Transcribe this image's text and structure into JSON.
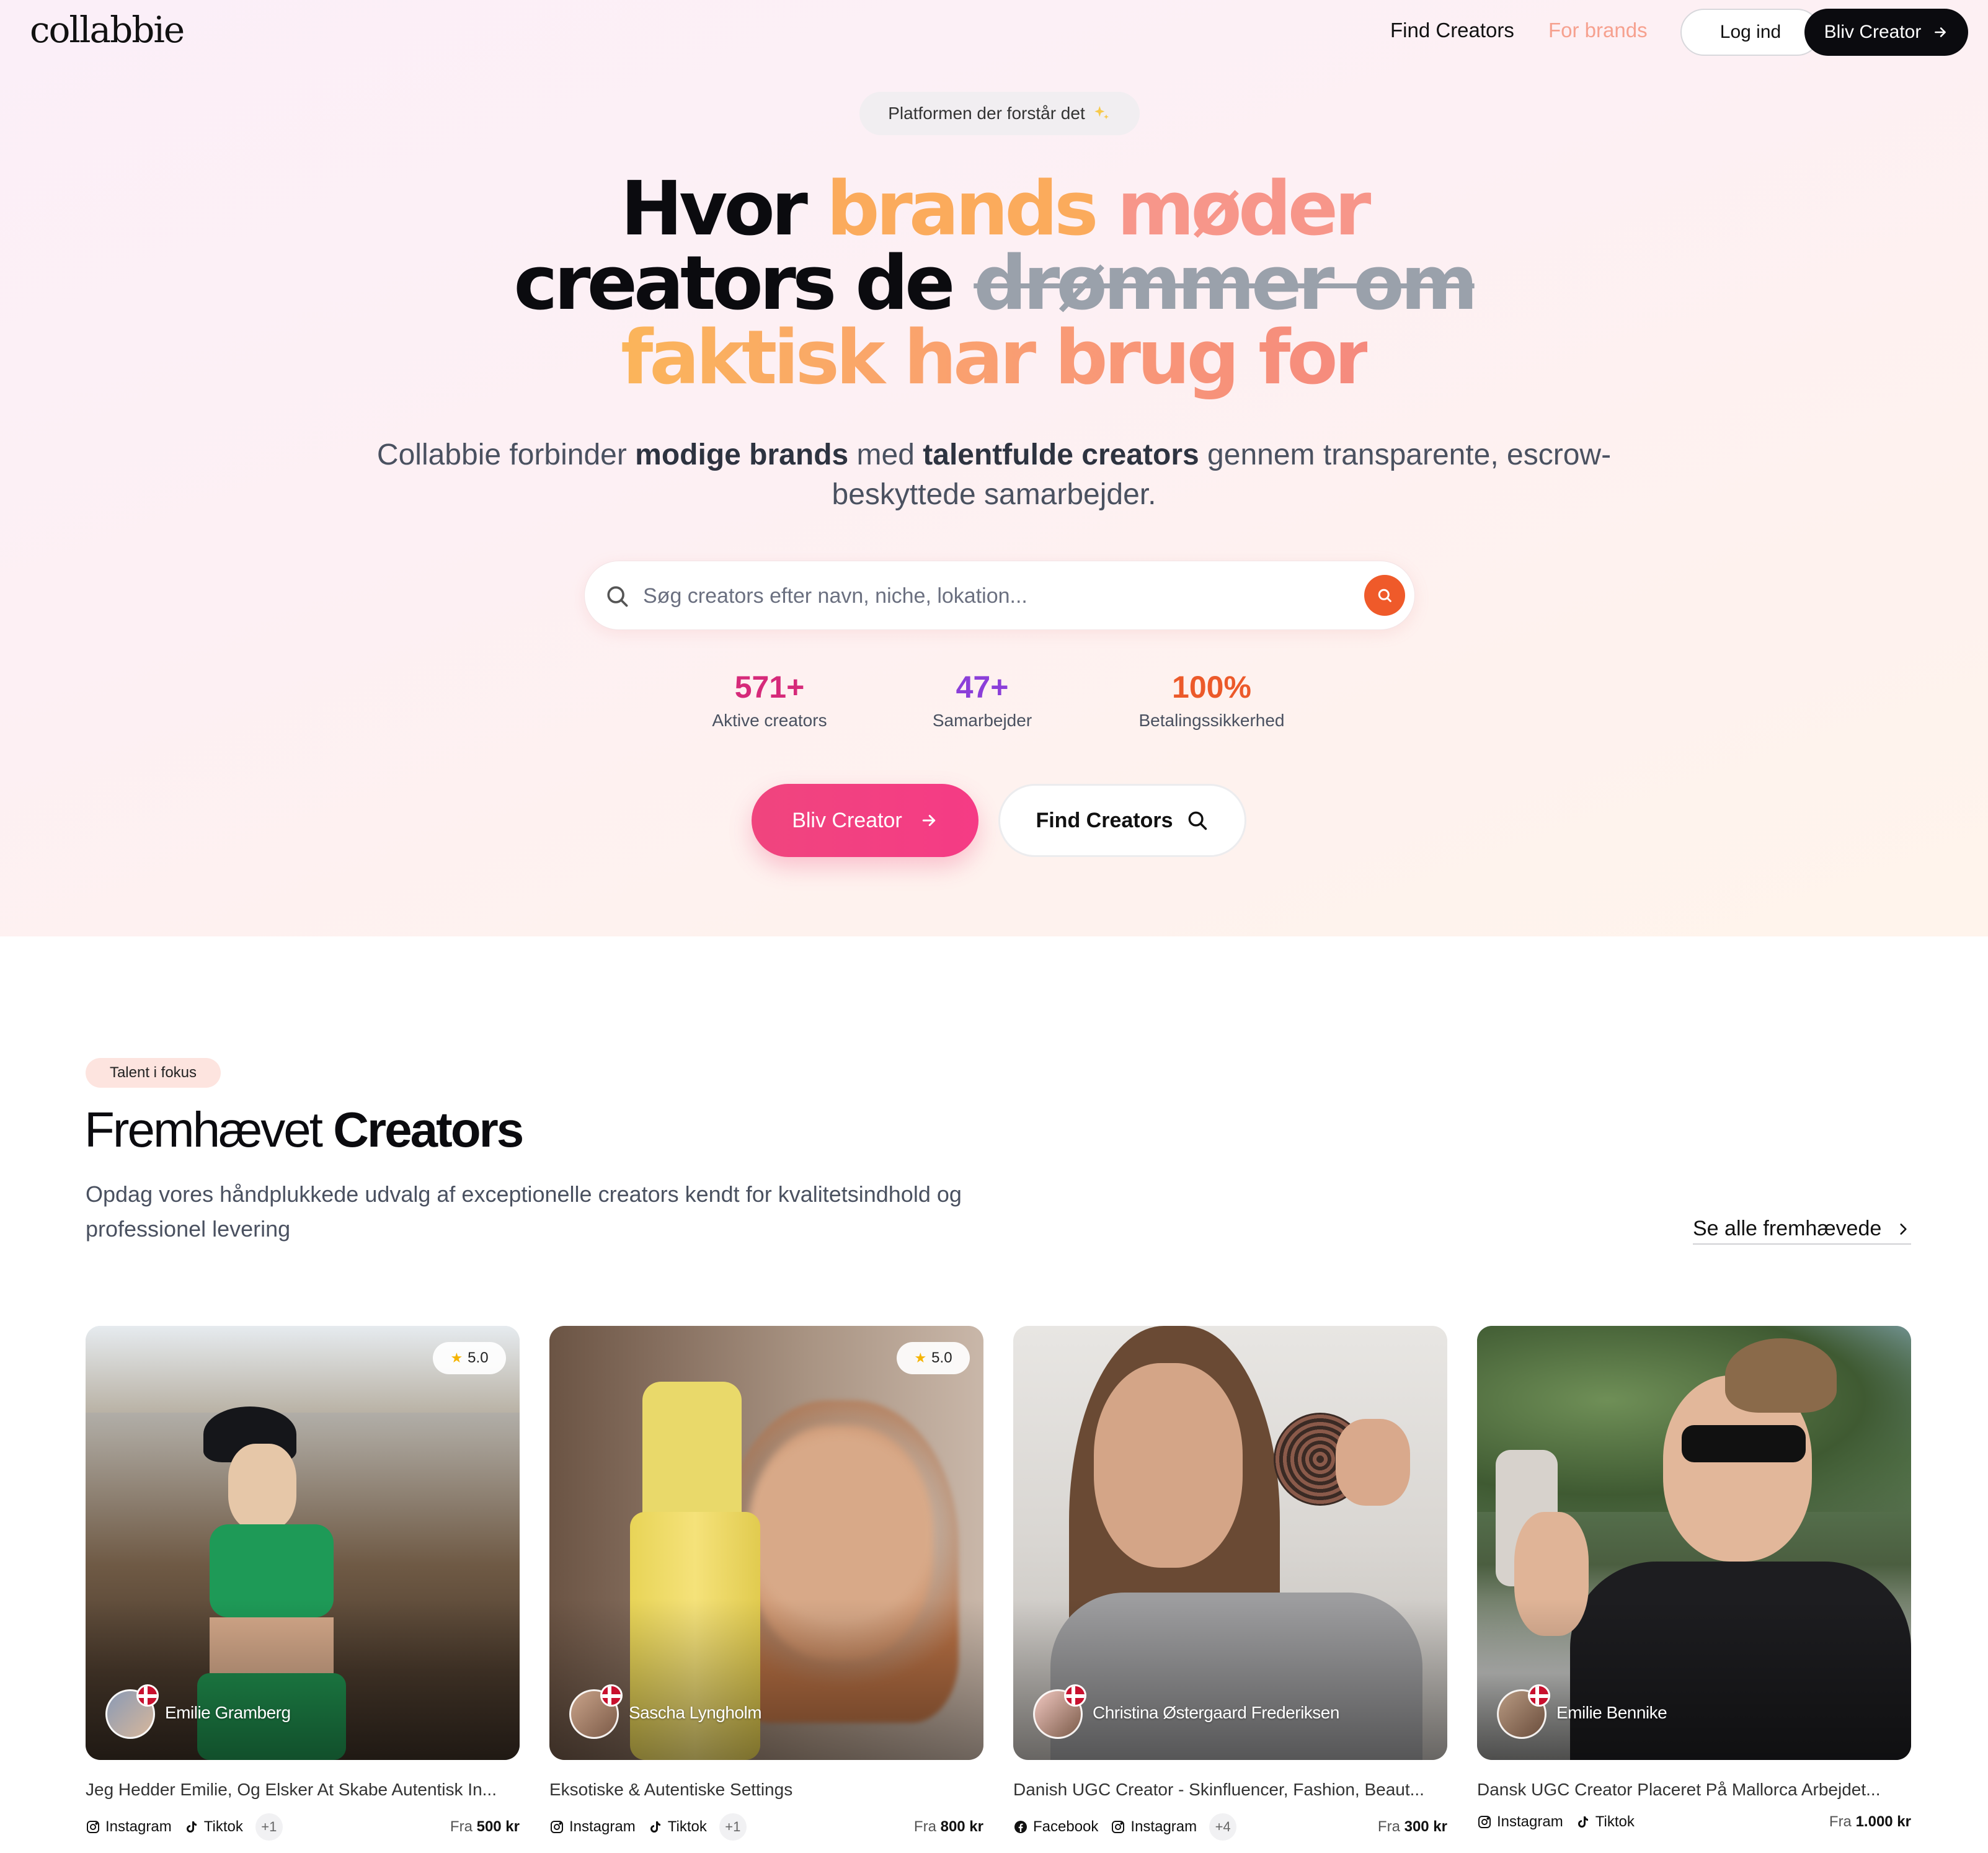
{
  "nav": {
    "logo": "collabbie",
    "find_creators": "Find Creators",
    "for_brands": "For brands",
    "login": "Log ind",
    "become_creator": "Bliv Creator"
  },
  "hero": {
    "badge": "Platformen der forstår det",
    "badge_icon": "sparkles-icon",
    "headline": {
      "w1": "Hvor",
      "w2": "brands",
      "w3": "møder",
      "w4": "creators de",
      "w5": "drømmer om",
      "w6": "faktisk har brug for"
    },
    "subtitle": {
      "p1": "Collabbie forbinder ",
      "b1": "modige brands",
      "p2": " med ",
      "b2": "talentfulde creators",
      "p3": " gennem transparente, escrow-beskyttede samarbejder."
    },
    "search_placeholder": "Søg creators efter navn, niche, lokation...",
    "stats": [
      {
        "value": "571+",
        "label": "Aktive creators",
        "color": "#d62a7a"
      },
      {
        "value": "47+",
        "label": "Samarbejder",
        "color": "#8b3fd9"
      },
      {
        "value": "100%",
        "label": "Betalingssikkerhed",
        "color": "#ec5a2a"
      }
    ],
    "cta_primary": "Bliv Creator",
    "cta_secondary": "Find Creators"
  },
  "featured": {
    "tag": "Talent i fokus",
    "title_light": "Fremhævet ",
    "title_bold": "Creators",
    "description": "Opdag vores håndplukkede udvalg af exceptionelle creators kendt for kvalitetsindhold og professionel levering",
    "see_all": "Se alle fremhævede",
    "price_prefix": "Fra ",
    "cards": [
      {
        "name": "Emilie Gramberg",
        "rating": "5.0",
        "description": "Jeg Hedder Emilie, Og Elsker At Skabe Autentisk In...",
        "platforms": [
          "Instagram",
          "Tiktok"
        ],
        "extra": "+1",
        "price": "500 kr"
      },
      {
        "name": "Sascha Lyngholm",
        "rating": "5.0",
        "description": "Eksotiske & Autentiske Settings",
        "platforms": [
          "Instagram",
          "Tiktok"
        ],
        "extra": "+1",
        "price": "800 kr"
      },
      {
        "name": "Christina Østergaard Frederiksen",
        "rating": "",
        "description": "Danish UGC Creator - Skinfluencer, Fashion, Beaut...",
        "platforms": [
          "Facebook",
          "Instagram"
        ],
        "extra": "+4",
        "price": "300 kr"
      },
      {
        "name": "Emilie Bennike",
        "rating": "",
        "description": "Dansk UGC Creator Placeret På Mallorca Arbejdet...",
        "platforms": [
          "Instagram",
          "Tiktok"
        ],
        "extra": "",
        "price": "1.000 kr"
      }
    ]
  }
}
